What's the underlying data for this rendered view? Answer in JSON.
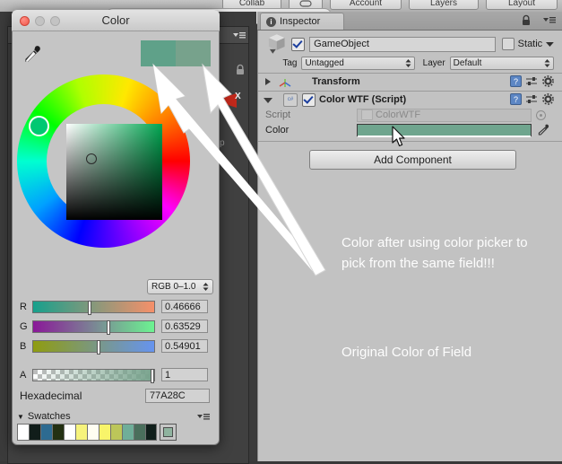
{
  "window_title": "Color",
  "toolbar": {
    "collab": "Collab",
    "cloud": "Cloud",
    "account": "Account",
    "layers": "Layers",
    "layout": "Layout"
  },
  "scene": {
    "axis_label": "X",
    "persp_label": "sp"
  },
  "inspector": {
    "tab_label": "Inspector",
    "tab_badge": "i",
    "gameobject": {
      "name": "GameObject",
      "static_label": "Static",
      "enabled": true
    },
    "tag_label": "Tag",
    "tag_value": "Untagged",
    "layer_label": "Layer",
    "layer_value": "Default",
    "components": [
      {
        "title": "Transform",
        "expanded": false
      },
      {
        "title": "Color WTF (Script)",
        "expanded": true
      }
    ],
    "script_label": "Script",
    "script_value": "ColorWTF",
    "color_label": "Color",
    "color_value": "#6FA58E",
    "add_component_label": "Add Component"
  },
  "annotations": {
    "line1": "Color after using color picker to pick from the same field!!!",
    "line2": "Original Color of Field"
  },
  "color_picker": {
    "preview_new": "#5FA189",
    "preview_old": "#77A28C",
    "wheel_handle_color": "#00C872",
    "mode_label": "RGB 0–1.0",
    "channels": [
      {
        "label": "R",
        "value": "0.46666",
        "pos": 0.47,
        "from": "#17a08c",
        "to": "#f6906a"
      },
      {
        "label": "G",
        "value": "0.63529",
        "pos": 0.635,
        "from": "#8a1898",
        "to": "#6cf391"
      },
      {
        "label": "B",
        "value": "0.54901",
        "pos": 0.549,
        "from": "#8f9c10",
        "to": "#6694ef"
      },
      {
        "label": "A",
        "value": "1",
        "pos": 1.0,
        "from": "",
        "to": ""
      }
    ],
    "hex_label": "Hexadecimal",
    "hex_value": "77A28C",
    "swatches_label": "Swatches",
    "swatches": [
      "#ffffff",
      "#111d1a",
      "#2d6b91",
      "#233012",
      "#ffffff",
      "#f6f37c",
      "#fffef2",
      "#f8f46a",
      "#bcc659",
      "#6fae99",
      "#4a6f5c",
      "#101f1b"
    ],
    "selected_swatch": "#8FB39F"
  }
}
